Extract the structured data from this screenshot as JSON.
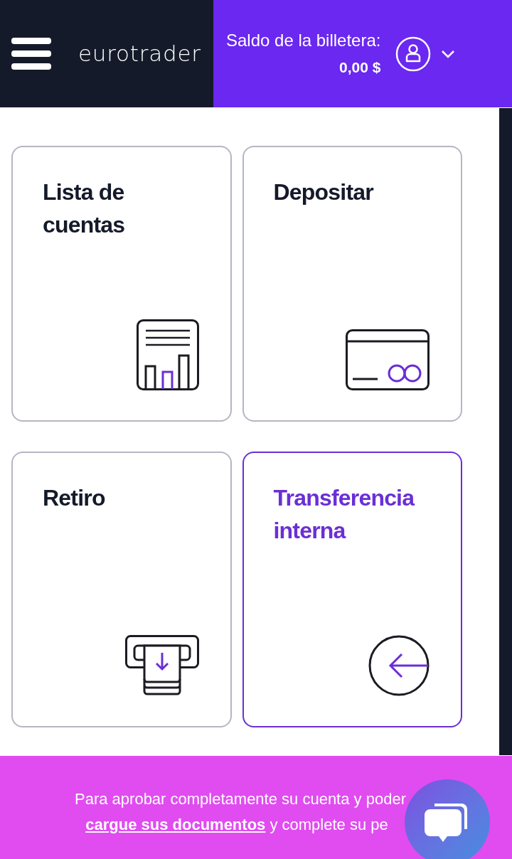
{
  "header": {
    "logo": "eurotrader",
    "wallet_label": "Saldo de la billetera:",
    "wallet_amount": "0,00 $"
  },
  "cards": [
    {
      "title": "Lista de cuentas",
      "kind": "report",
      "selected": false
    },
    {
      "title": "Depositar",
      "kind": "card",
      "selected": false
    },
    {
      "title": "Retiro",
      "kind": "atm",
      "selected": false
    },
    {
      "title": "Transferencia interna",
      "kind": "transfer",
      "selected": true
    }
  ],
  "banner": {
    "line1": "Para aprobar completamente su cuenta y poder",
    "link": "cargue sus documentos",
    "line2_rest": "y complete su pe"
  }
}
